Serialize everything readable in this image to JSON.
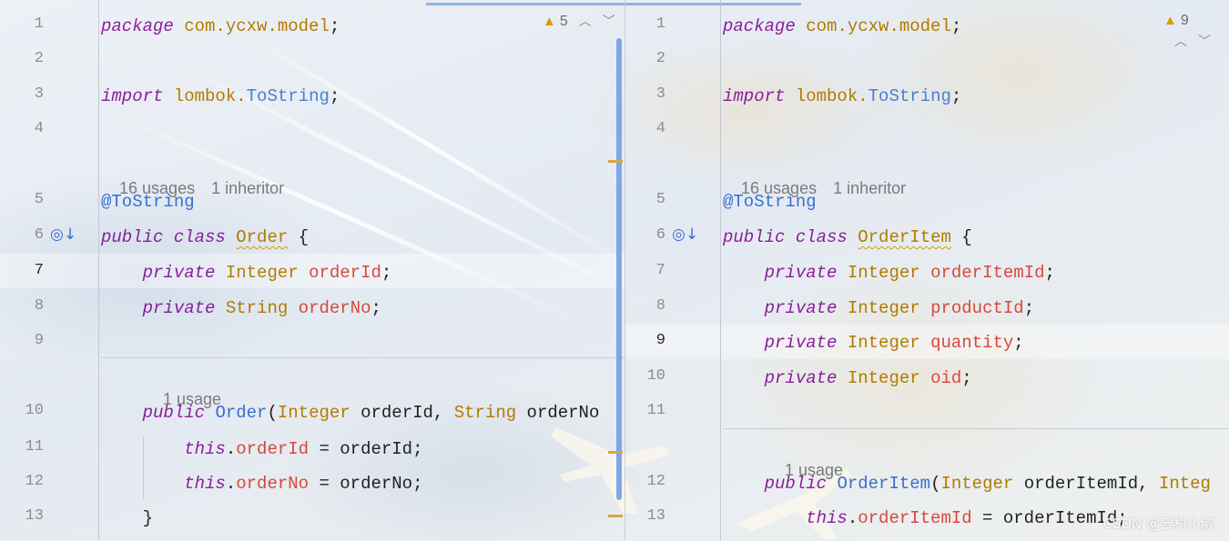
{
  "left_editor": {
    "inspection": {
      "icon": "warning-triangle-icon",
      "count": "5"
    },
    "lines": [
      {
        "num": "1",
        "tokens": [
          {
            "t": "package",
            "c": "kw"
          },
          {
            "t": " "
          },
          {
            "t": "com.ycxw.model",
            "c": "pkg"
          },
          {
            "t": ";"
          }
        ]
      },
      {
        "num": "2",
        "tokens": []
      },
      {
        "num": "3",
        "tokens": [
          {
            "t": "import",
            "c": "kw"
          },
          {
            "t": " "
          },
          {
            "t": "lombok.",
            "c": "pkg"
          },
          {
            "t": "ToString",
            "c": "cls"
          },
          {
            "t": ";"
          }
        ]
      },
      {
        "num": "4",
        "tokens": []
      },
      {
        "num": "5",
        "tokens": [
          {
            "t": "@ToString",
            "c": "ann"
          }
        ]
      },
      {
        "num": "6",
        "tokens": [
          {
            "t": "public",
            "c": "kw"
          },
          {
            "t": " "
          },
          {
            "t": "class",
            "c": "kw"
          },
          {
            "t": " "
          },
          {
            "t": "Order",
            "c": "typ wavy"
          },
          {
            "t": " {"
          }
        ]
      },
      {
        "num": "7",
        "tokens": [
          {
            "t": "    "
          },
          {
            "t": "private",
            "c": "kw"
          },
          {
            "t": " "
          },
          {
            "t": "Integer",
            "c": "typ"
          },
          {
            "t": " "
          },
          {
            "t": "orderId",
            "c": "fld"
          },
          {
            "t": ";"
          }
        ]
      },
      {
        "num": "8",
        "tokens": [
          {
            "t": "    "
          },
          {
            "t": "private",
            "c": "kw"
          },
          {
            "t": " "
          },
          {
            "t": "String",
            "c": "typ"
          },
          {
            "t": " "
          },
          {
            "t": "orderNo",
            "c": "fld"
          },
          {
            "t": ";"
          }
        ]
      },
      {
        "num": "9",
        "tokens": []
      },
      {
        "num": "10",
        "tokens": [
          {
            "t": "    "
          },
          {
            "t": "public",
            "c": "kw"
          },
          {
            "t": " "
          },
          {
            "t": "Order",
            "c": "m"
          },
          {
            "t": "("
          },
          {
            "t": "Integer",
            "c": "typ"
          },
          {
            "t": " orderId, "
          },
          {
            "t": "String",
            "c": "typ"
          },
          {
            "t": " orderNo"
          }
        ]
      },
      {
        "num": "11",
        "tokens": [
          {
            "t": "        "
          },
          {
            "t": "this",
            "c": "kw"
          },
          {
            "t": "."
          },
          {
            "t": "orderId",
            "c": "fld"
          },
          {
            "t": " = orderId;"
          }
        ]
      },
      {
        "num": "12",
        "tokens": [
          {
            "t": "        "
          },
          {
            "t": "this",
            "c": "kw"
          },
          {
            "t": "."
          },
          {
            "t": "orderNo",
            "c": "fld"
          },
          {
            "t": " = orderNo;"
          }
        ]
      },
      {
        "num": "13",
        "tokens": [
          {
            "t": "    }"
          }
        ]
      }
    ],
    "hints": {
      "class_usages": "16 usages",
      "class_inheritors": "1 inheritor",
      "ctor_usages": "1 usage"
    },
    "current_line": "7"
  },
  "right_editor": {
    "inspection": {
      "icon": "warning-triangle-icon",
      "count": "9"
    },
    "lines": [
      {
        "num": "1",
        "tokens": [
          {
            "t": "package",
            "c": "kw"
          },
          {
            "t": " "
          },
          {
            "t": "com.ycxw.model",
            "c": "pkg"
          },
          {
            "t": ";"
          }
        ]
      },
      {
        "num": "2",
        "tokens": []
      },
      {
        "num": "3",
        "tokens": [
          {
            "t": "import",
            "c": "kw"
          },
          {
            "t": " "
          },
          {
            "t": "lombok.",
            "c": "pkg"
          },
          {
            "t": "ToString",
            "c": "cls"
          },
          {
            "t": ";"
          }
        ]
      },
      {
        "num": "4",
        "tokens": []
      },
      {
        "num": "5",
        "tokens": [
          {
            "t": "@ToString",
            "c": "ann"
          }
        ]
      },
      {
        "num": "6",
        "tokens": [
          {
            "t": "public",
            "c": "kw"
          },
          {
            "t": " "
          },
          {
            "t": "class",
            "c": "kw"
          },
          {
            "t": " "
          },
          {
            "t": "OrderItem",
            "c": "typ wavy"
          },
          {
            "t": " {"
          }
        ]
      },
      {
        "num": "7",
        "tokens": [
          {
            "t": "    "
          },
          {
            "t": "private",
            "c": "kw"
          },
          {
            "t": " "
          },
          {
            "t": "Integer",
            "c": "typ"
          },
          {
            "t": " "
          },
          {
            "t": "orderItemId",
            "c": "fld"
          },
          {
            "t": ";"
          }
        ]
      },
      {
        "num": "8",
        "tokens": [
          {
            "t": "    "
          },
          {
            "t": "private",
            "c": "kw"
          },
          {
            "t": " "
          },
          {
            "t": "Integer",
            "c": "typ"
          },
          {
            "t": " "
          },
          {
            "t": "productId",
            "c": "fld"
          },
          {
            "t": ";"
          }
        ]
      },
      {
        "num": "9",
        "tokens": [
          {
            "t": "    "
          },
          {
            "t": "private",
            "c": "kw"
          },
          {
            "t": " "
          },
          {
            "t": "Integer",
            "c": "typ"
          },
          {
            "t": " "
          },
          {
            "t": "quantity",
            "c": "fld"
          },
          {
            "t": ";"
          }
        ]
      },
      {
        "num": "10",
        "tokens": [
          {
            "t": "    "
          },
          {
            "t": "private",
            "c": "kw"
          },
          {
            "t": " "
          },
          {
            "t": "Integer",
            "c": "typ"
          },
          {
            "t": " "
          },
          {
            "t": "oid",
            "c": "fld"
          },
          {
            "t": ";"
          }
        ]
      },
      {
        "num": "11",
        "tokens": []
      },
      {
        "num": "12",
        "tokens": [
          {
            "t": "    "
          },
          {
            "t": "public",
            "c": "kw"
          },
          {
            "t": " "
          },
          {
            "t": "OrderItem",
            "c": "m"
          },
          {
            "t": "("
          },
          {
            "t": "Integer",
            "c": "typ"
          },
          {
            "t": " orderItemId, "
          },
          {
            "t": "Integ",
            "c": "typ"
          }
        ]
      },
      {
        "num": "13",
        "tokens": [
          {
            "t": "        "
          },
          {
            "t": "this",
            "c": "kw"
          },
          {
            "t": "."
          },
          {
            "t": "orderItemId",
            "c": "fld"
          },
          {
            "t": " = orderItemId;"
          }
        ]
      }
    ],
    "hints": {
      "class_usages": "16 usages",
      "class_inheritors": "1 inheritor",
      "ctor_usages": "1 usage"
    },
    "current_line": "9"
  },
  "gutter_icon": "override-implementation-icon",
  "watermark": "CSDN @云村小威",
  "colors": {
    "keyword": "#8a1e9c",
    "type": "#b27b00",
    "field": "#d6493a",
    "annotation": "#3a6fd0",
    "scroll_thumb": "#7ea6ea",
    "warning": "#d99a00"
  }
}
